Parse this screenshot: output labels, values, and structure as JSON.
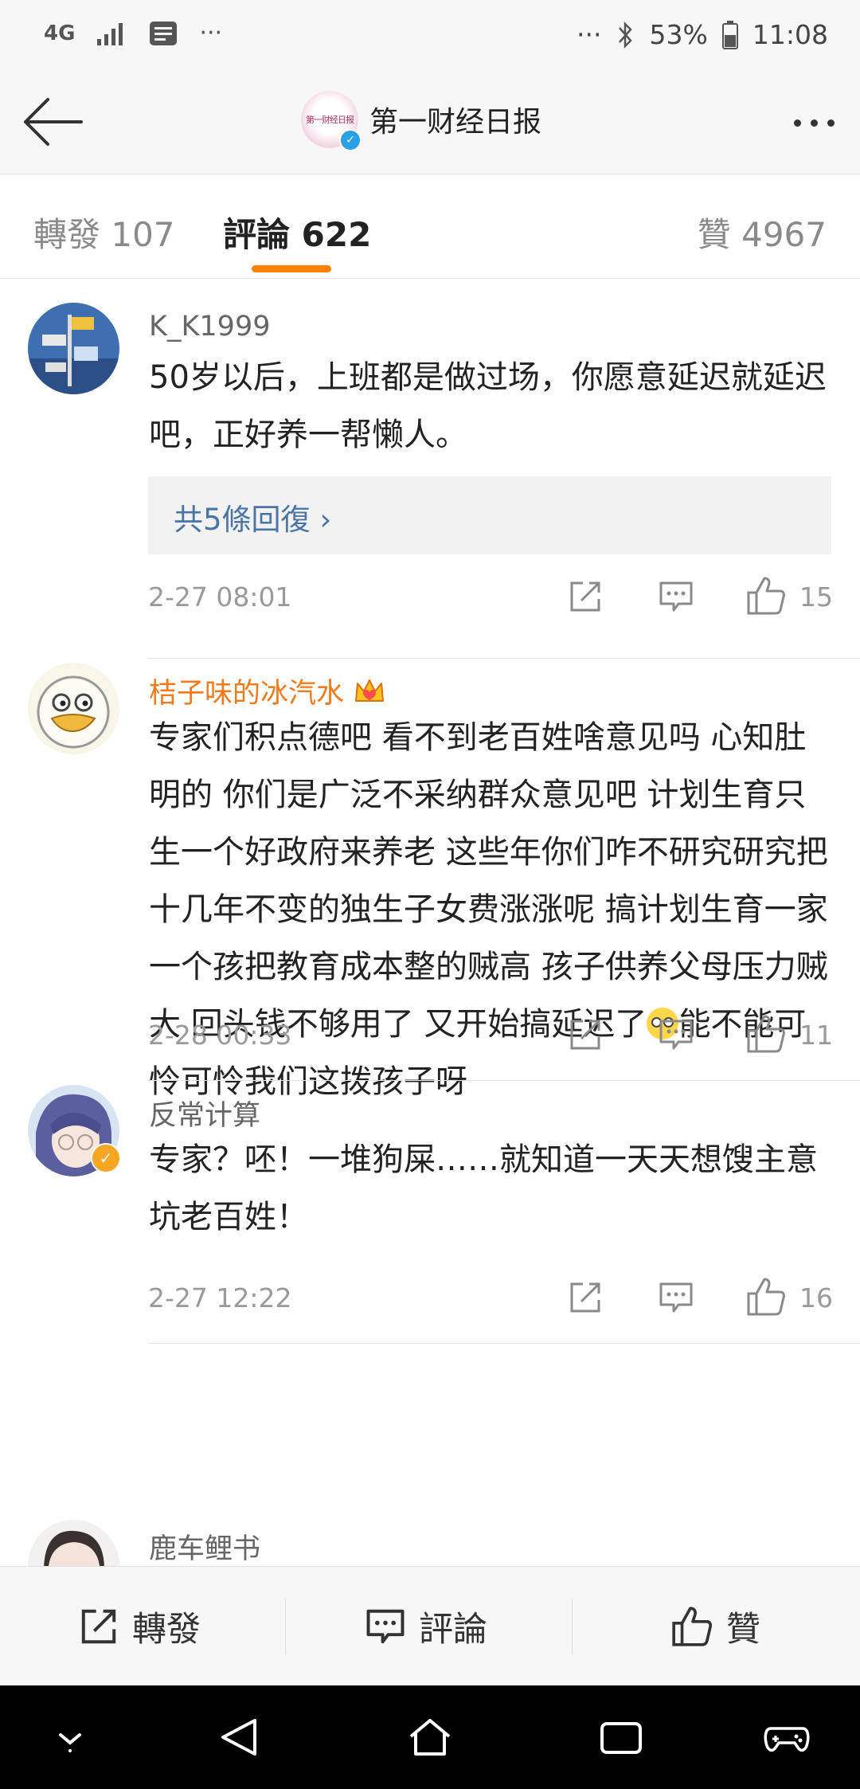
{
  "status_bar": {
    "network": "4G",
    "more": "···",
    "more_right": "···",
    "battery": "53%",
    "time": "11:08"
  },
  "header": {
    "title": "第一财经日报",
    "avatar_logo_text": "第一财经日报"
  },
  "tabs": [
    {
      "label": "轉發 107"
    },
    {
      "label": "評論 622"
    },
    {
      "label": "贊 4967"
    }
  ],
  "comments": [
    {
      "username": "K_K1999",
      "text": "50岁以后，上班都是做过场，你愿意延迟就延迟吧，正好养一帮懒人。",
      "replies": "共5條回復",
      "time": "2-27 08:01",
      "likes": "15"
    },
    {
      "username": "桔子味的冰汽水",
      "text_before_emoji": "专家们积点德吧 看不到老百姓啥意见吗 心知肚明的 你们是广泛不采纳群众意见吧 计划生育只生一个好政府来养老 这些年你们咋不研究研究把十几年不变的独生子女费涨涨呢 搞计划生育一家一个孩把教育成本整的贼高 孩子供养父母压力贼大 回头钱不够用了 又开始搞延迟了",
      "text_after_emoji": "能不能可怜可怜我们这拨孩子呀",
      "time": "2-28 00:33",
      "likes": "11"
    },
    {
      "username": "反常计算",
      "text": "专家？呸！一堆狗屎……就知道一天天想馊主意坑老百姓！",
      "time": "2-27 12:22",
      "likes": "16"
    },
    {
      "username": "鹿车鲤书"
    }
  ],
  "bottom_bar": {
    "repost": "轉發",
    "comment": "評論",
    "like": "贊"
  },
  "colors": {
    "accent": "#ff8200",
    "link": "#4a74a6",
    "vip_name": "#f07b1c"
  }
}
